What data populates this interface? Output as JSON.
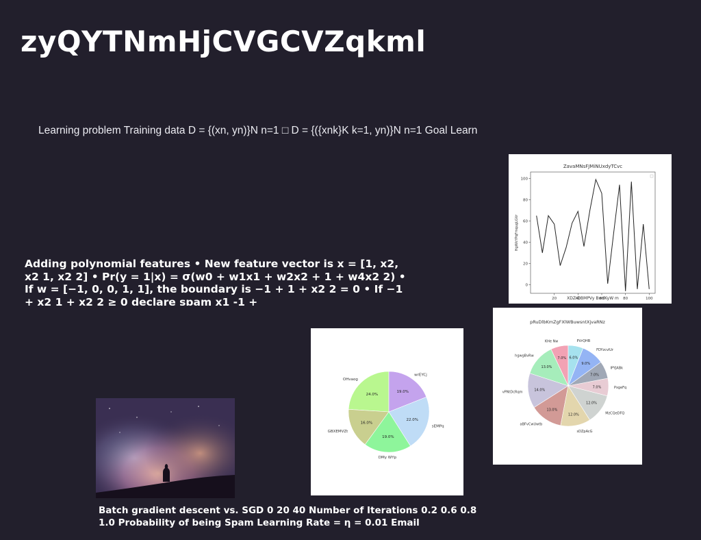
{
  "slide": {
    "title": "zyQYTNmHjCVGCVZqkml",
    "subtitle": "Learning problem Training data D = {(xn, yn)}N n=1 □ D = {({xnk}K k=1, yn)}N n=1 Goal Learn",
    "polynomial_text": "Adding polynomial features • New feature vector is x = [1, x2, x2 1, x2 2] • Pr(y = 1|x) = σ(w0 + w1x1 + w2x2 + 1 + w4x2 2) • If w = [−1, 0, 0, 1, 1], the boundary is −1 + 1 + x2 2 = 0 • If −1 + x2 1 + x2 2 ≥ 0 declare spam x1 -1 +",
    "bottom_text": "Batch gradient descent vs. SGD 0 20 40 Number of Iterations 0.2 0.6 0.8 1.0 Probability of being Spam Learning Rate = η = 0.01 Email"
  },
  "chart_data": [
    {
      "type": "line",
      "title": "ZavaMNsFJMiNUxdyTCvc",
      "xlabel": "XDZrDBMPVy BwdKyW m",
      "ylabel": "HgWkYPqFmqugLGVr",
      "x": [
        5,
        10,
        15,
        20,
        25,
        30,
        35,
        40,
        45,
        50,
        55,
        60,
        65,
        70,
        75,
        80,
        85,
        90,
        95,
        100
      ],
      "y": [
        65,
        30,
        65,
        57,
        18,
        35,
        58,
        69,
        36,
        70,
        99,
        86,
        1,
        48,
        94,
        -6,
        97,
        -4,
        57,
        -4
      ],
      "xlim": [
        0,
        105
      ],
      "ylim": [
        -8,
        106
      ],
      "xticks": [
        20,
        40,
        60,
        80,
        100
      ],
      "yticks": [
        0,
        20,
        40,
        60,
        80,
        100
      ],
      "color": "#222222",
      "grid": false
    },
    {
      "type": "pie",
      "labels": [
        "OHvaog",
        "GBXEMVZt",
        "DMy WYp",
        "sEMPq",
        "wrEYCj"
      ],
      "values": [
        24.0,
        16.0,
        19.0,
        22.0,
        19.0
      ],
      "autopct": [
        "24.0%",
        "16.0%",
        "19.0%",
        "22.0%",
        "19.0%"
      ],
      "colors": [
        "#b9f78f",
        "#c9cf8f",
        "#8ef59b",
        "#bfdcf6",
        "#c4a3ed"
      ]
    },
    {
      "type": "pie",
      "title": "pRuDlbKmZgFXlWBuwsntXjvaRNz",
      "labels": [
        "KHe Nw",
        "hgwgBvRw",
        "vPNtDcRqm",
        "aBFvCwUwtb",
        "sDZpAcG",
        "MzCQeDFQ",
        "PxgeFq",
        "IPYJABk",
        "FDYzcvlUr",
        "PVrQHB"
      ],
      "values": [
        7.0,
        13.0,
        14.0,
        13.0,
        12.0,
        12.0,
        7.0,
        7.0,
        9.0,
        6.0
      ],
      "autopct": [
        "7.0%",
        "13.0%",
        "14.0%",
        "13.0%",
        "12.0%",
        "12.0%",
        "7.0%",
        "7.0%",
        "9.0%",
        "6.0%"
      ],
      "colors": [
        "#f2a2b4",
        "#a6edbb",
        "#c8c4dc",
        "#d29a96",
        "#e3d6ad",
        "#cfd3d1",
        "#e8ccd4",
        "#a0a8b6",
        "#94b4f4",
        "#a6e2ee"
      ]
    }
  ],
  "photo": {
    "colors": [
      "#3a2f52",
      "#e7b1a2",
      "#c67fa3",
      "#a6c6de",
      "#160f1c"
    ]
  }
}
